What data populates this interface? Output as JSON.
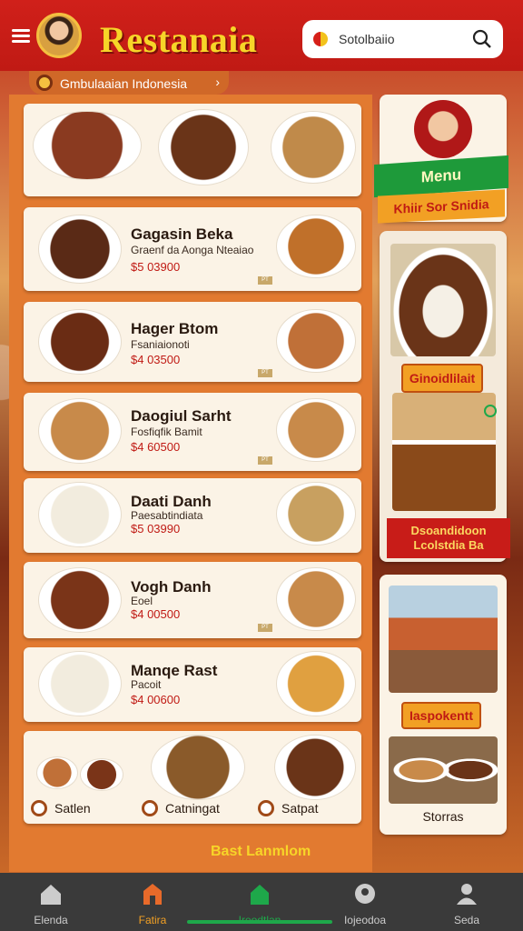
{
  "header": {
    "brand": "Restanaia",
    "search_placeholder": "Sotolbaiio",
    "menu_icon": "hamburger-icon",
    "search_icon": "magnifier-icon"
  },
  "breadcrumb": {
    "label": "Gmbulaaian Indonesia",
    "chevron": "›"
  },
  "top_dishes": [
    {
      "color": "#8a3a20"
    },
    {
      "color": "#6a3418"
    },
    {
      "color": "#c08a4a"
    }
  ],
  "menu_items": [
    {
      "title": "Gagasin Beka",
      "subtitle": "Graenf da Aonga Nteaiao",
      "price": "$5 03900",
      "tag": "PT",
      "dish": "#5a2a16",
      "side": "#c0702a"
    },
    {
      "title": "Hager Btom",
      "subtitle": "Fsaniaionoti",
      "price": "$4 03500",
      "tag": "PT",
      "dish": "#6a2c14",
      "side": "#c07038"
    },
    {
      "title": "Daogiul Sarht",
      "subtitle": "Fosfiqfik Bamit",
      "price": "$4 60500",
      "tag": "PT",
      "dish": "#c88a4a",
      "side": "#c88a4a"
    },
    {
      "title": "Daati Danh",
      "subtitle": "Paesabtindiata",
      "price": "$5 03990",
      "tag": "PT",
      "dish": "#f2ecde",
      "side": "#c8a060"
    },
    {
      "title": "Vogh Danh",
      "subtitle": "Eoel",
      "price": "$4 00500",
      "tag": "PT",
      "dish": "#7a3418",
      "side": "#c88a4a"
    },
    {
      "title": "Manqe Rast",
      "subtitle": "Pacoit",
      "price": "$4 00600",
      "tag": "PT",
      "dish": "#f2ecde",
      "side": "#e0a040"
    }
  ],
  "bottom_chips": [
    {
      "label": "Satlen"
    },
    {
      "label": "Catningat"
    },
    {
      "label": "Satpat"
    }
  ],
  "footer_link": "Bast Lanmlom",
  "side": {
    "menu_ribbon": "Menu",
    "sub_ribbon": "Khiir Sor Snidia",
    "label1": "Ginoidlilait",
    "banner": "Dsoandidoon Lcolstdia Ba",
    "label2": "Iaspokentt",
    "caption": "Storras"
  },
  "nav": [
    {
      "label": "Elenda",
      "icon": "home-icon"
    },
    {
      "label": "Fatira",
      "icon": "store-icon"
    },
    {
      "label": "Ireodtlan",
      "icon": "shop-icon"
    },
    {
      "label": "Iojeodoa",
      "icon": "account-icon"
    },
    {
      "label": "Seda",
      "icon": "person-icon"
    }
  ],
  "colors": {
    "accent": "#f7d528",
    "primary": "#c01a14",
    "active_nav": "#1ea84a"
  }
}
